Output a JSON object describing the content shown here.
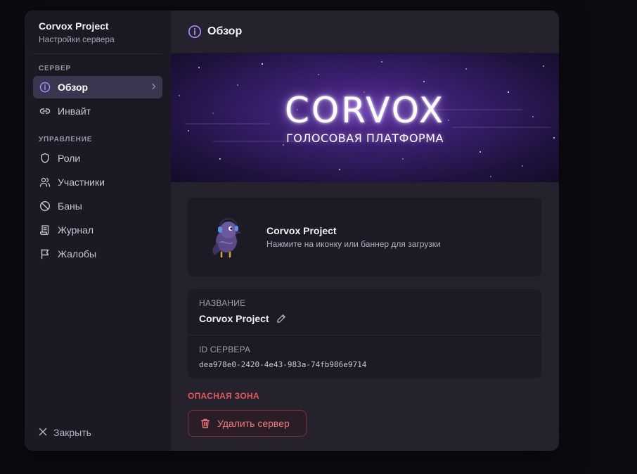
{
  "server": {
    "name": "Corvox Project",
    "subtitle": "Настройки сервера"
  },
  "sidebar": {
    "section_server": "СЕРВЕР",
    "section_manage": "УПРАВЛЕНИЕ",
    "items": [
      {
        "label": "Обзор",
        "icon": "info-icon",
        "active": true
      },
      {
        "label": "Инвайт",
        "icon": "link-icon"
      },
      {
        "label": "Роли",
        "icon": "shield-icon"
      },
      {
        "label": "Участники",
        "icon": "users-icon"
      },
      {
        "label": "Баны",
        "icon": "ban-icon"
      },
      {
        "label": "Журнал",
        "icon": "scroll-icon"
      },
      {
        "label": "Жалобы",
        "icon": "flag-icon"
      }
    ],
    "close_label": "Закрыть"
  },
  "header": {
    "title": "Обзор"
  },
  "banner": {
    "logo_text": "CORVOX",
    "tagline": "ГОЛОСОВАЯ ПЛАТФОРМА"
  },
  "profile": {
    "name": "Corvox Project",
    "hint": "Нажмите на иконку или баннер для загрузки"
  },
  "info": {
    "name_label": "НАЗВАНИЕ",
    "name_value": "Corvox Project",
    "id_label": "ID СЕРВЕРА",
    "id_value": "dea978e0-2420-4e43-983a-74fb986e9714"
  },
  "danger": {
    "label": "ОПАСНАЯ ЗОНА",
    "delete_label": "Удалить сервер"
  },
  "colors": {
    "accent": "#8b5cf6",
    "danger": "#e5575a",
    "sidebar_bg": "#1b1923",
    "panel_bg": "#25222e"
  }
}
